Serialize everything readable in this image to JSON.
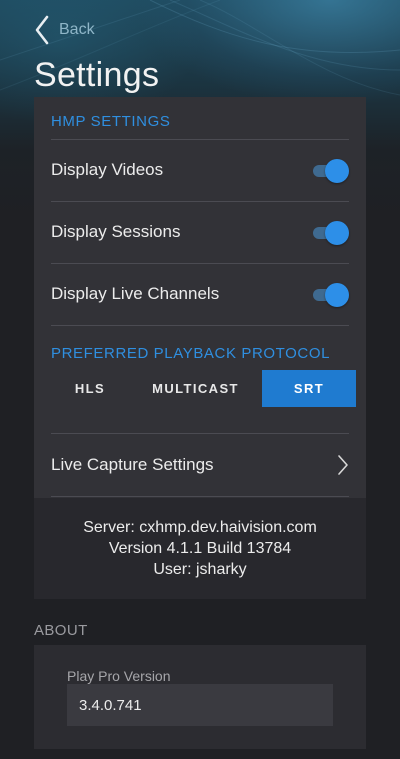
{
  "nav": {
    "back_label": "Back"
  },
  "page": {
    "title": "Settings"
  },
  "hmp_settings": {
    "section_label": "HMP SETTINGS",
    "rows": [
      {
        "label": "Display Videos",
        "enabled": true
      },
      {
        "label": "Display Sessions",
        "enabled": true
      },
      {
        "label": "Display Live Channels",
        "enabled": true
      }
    ]
  },
  "playback": {
    "section_label": "PREFERRED PLAYBACK PROTOCOL",
    "options": [
      "HLS",
      "MULTICAST",
      "SRT"
    ],
    "selected": "SRT"
  },
  "live_capture": {
    "label": "Live Capture Settings"
  },
  "server_info": {
    "server": "Server: cxhmp.dev.haivision.com",
    "version": "Version 4.1.1 Build 13784",
    "user": "User: jsharky"
  },
  "about": {
    "section_label": "ABOUT",
    "play_pro_label": "Play Pro Version",
    "play_pro_value": "3.4.0.741"
  },
  "colors": {
    "accent": "#2d8fe8",
    "selected_option_bg": "#1f7bd0",
    "panel_bg": "#323237",
    "page_bg": "#1f2024"
  },
  "icons": {
    "back": "chevron-left-icon",
    "disclosure": "chevron-right-icon"
  }
}
